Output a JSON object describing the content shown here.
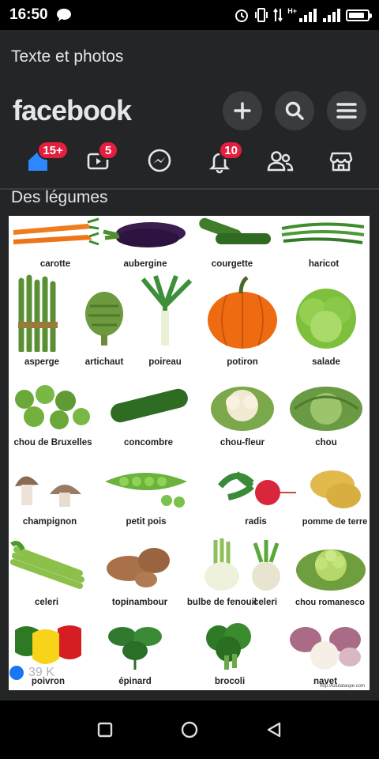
{
  "status": {
    "time": "16:50",
    "network": "H+"
  },
  "app": {
    "prev_post_text": "Texte et photos",
    "logo": "facebook",
    "tabs": [
      {
        "name": "home",
        "badge": "15+"
      },
      {
        "name": "watch",
        "badge": "5"
      },
      {
        "name": "messenger",
        "badge": ""
      },
      {
        "name": "notifications",
        "badge": "10"
      },
      {
        "name": "friends",
        "badge": ""
      },
      {
        "name": "marketplace",
        "badge": ""
      }
    ],
    "post_text": "Des légumes",
    "poster": {
      "items": [
        "carotte",
        "aubergine",
        "courgette",
        "haricot",
        "asperge",
        "artichaut",
        "poireau",
        "potiron",
        "salade",
        "chou de Bruxelles",
        "concombre",
        "chou-fleur",
        "chou",
        "champignon",
        "petit pois",
        "radis",
        "pomme de terre",
        "celeri",
        "topinambour",
        "bulbe de fenouil",
        "celeri",
        "chou romanesco",
        "poivron",
        "épinard",
        "brocoli",
        "navet"
      ],
      "credit": "http://lululataupe.com"
    },
    "reaction_count": "39 K"
  },
  "colors": {
    "accent": "#1877f2",
    "badge": "#e41e3f",
    "background": "#242526"
  }
}
